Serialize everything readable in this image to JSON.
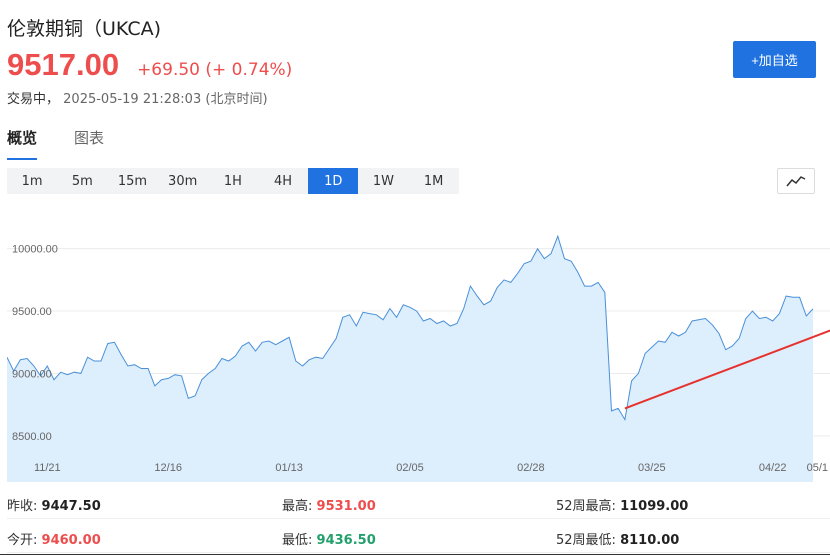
{
  "header": {
    "title": "伦敦期铜（UKCA)",
    "price": "9517.00",
    "change": "+69.50 (+ 0.74%)",
    "status_label": "交易中，",
    "timestamp": "2025-05-19 21:28:03",
    "timezone": "(北京时间)",
    "add_button": "+加自选"
  },
  "tabs": [
    {
      "label": "概览",
      "active": true
    },
    {
      "label": "图表",
      "active": false
    }
  ],
  "periods": [
    "1m",
    "5m",
    "15m",
    "30m",
    "1H",
    "4H",
    "1D",
    "1W",
    "1M"
  ],
  "active_period": "1D",
  "colors": {
    "accent": "#1f72e0",
    "up": "#ee4d4d",
    "down": "#22a06b",
    "area": "#ddeefc",
    "line": "#4a90d9",
    "arrow": "#e6322e"
  },
  "chart_data": {
    "type": "area",
    "y_ticks": [
      "10000.00",
      "9500.00",
      "9000.00",
      "8500.00"
    ],
    "y_tick_values": [
      10000,
      9500,
      9000,
      8500
    ],
    "ylim": [
      8130,
      10350
    ],
    "x_labels": [
      "11/21",
      "12/16",
      "01/13",
      "02/05",
      "02/28",
      "03/25",
      "04/22",
      "05/1"
    ],
    "x_label_index": [
      6,
      24,
      42,
      60,
      78,
      96,
      114,
      131
    ],
    "series": [
      {
        "values": [
          9130,
          9020,
          9110,
          9120,
          9060,
          8980,
          9060,
          8950,
          9010,
          8990,
          9010,
          9000,
          9130,
          9100,
          9100,
          9240,
          9250,
          9150,
          9060,
          9070,
          9040,
          9040,
          8900,
          8950,
          8960,
          8990,
          8980,
          8800,
          8820,
          8950,
          9000,
          9040,
          9120,
          9100,
          9140,
          9220,
          9250,
          9180,
          9250,
          9260,
          9230,
          9260,
          9290,
          9100,
          9060,
          9110,
          9130,
          9120,
          9200,
          9280,
          9450,
          9470,
          9380,
          9490,
          9480,
          9470,
          9430,
          9520,
          9450,
          9550,
          9530,
          9500,
          9420,
          9440,
          9400,
          9420,
          9380,
          9400,
          9520,
          9700,
          9620,
          9550,
          9580,
          9690,
          9750,
          9730,
          9800,
          9880,
          9900,
          10000,
          9920,
          9960,
          10100,
          9920,
          9900,
          9810,
          9700,
          9700,
          9730,
          9650,
          8700,
          8720,
          8630,
          8940,
          9000,
          9160,
          9210,
          9260,
          9250,
          9330,
          9300,
          9330,
          9420,
          9430,
          9440,
          9390,
          9320,
          9190,
          9220,
          9280,
          9440,
          9500,
          9440,
          9450,
          9420,
          9480,
          9620,
          9610,
          9610,
          9460,
          9517
        ]
      }
    ],
    "annotation": {
      "type": "arrow",
      "from_index": 92,
      "from_value": 8720,
      "to_index": 131,
      "to_value": 9520
    }
  },
  "stats": [
    {
      "label": "昨收:",
      "value": "9447.50",
      "tone": "neutral"
    },
    {
      "label": "最高:",
      "value": "9531.00",
      "tone": "up"
    },
    {
      "label": "52周最高:",
      "value": "11099.00",
      "tone": "neutral"
    },
    {
      "label": "今开:",
      "value": "9460.00",
      "tone": "up"
    },
    {
      "label": "最低:",
      "value": "9436.50",
      "tone": "down"
    },
    {
      "label": "52周最低:",
      "value": "8110.00",
      "tone": "neutral"
    }
  ]
}
